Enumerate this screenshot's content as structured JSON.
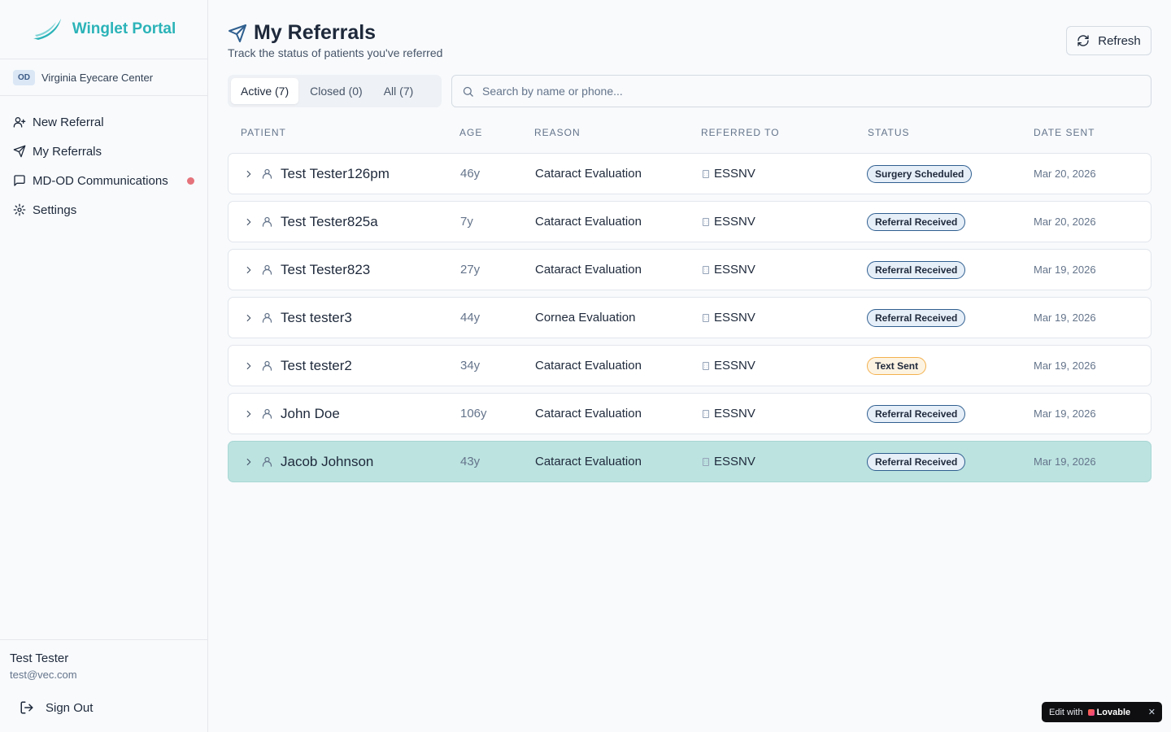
{
  "brand": {
    "title": "Winglet Portal"
  },
  "org": {
    "badge": "OD",
    "name": "Virginia Eyecare Center"
  },
  "nav": {
    "items": [
      {
        "label": "New Referral",
        "icon": "user-plus-icon"
      },
      {
        "label": "My Referrals",
        "icon": "send-icon"
      },
      {
        "label": "MD-OD Communications",
        "icon": "message-icon",
        "has_notification": true
      },
      {
        "label": "Settings",
        "icon": "gear-icon"
      }
    ]
  },
  "user": {
    "name": "Test Tester",
    "email": "test@vec.com",
    "signout_label": "Sign Out"
  },
  "header": {
    "title": "My Referrals",
    "subtitle": "Track the status of patients you've referred",
    "refresh_label": "Refresh"
  },
  "tabs": [
    {
      "label": "Active (7)",
      "active": true
    },
    {
      "label": "Closed (0)",
      "active": false
    },
    {
      "label": "All (7)",
      "active": false
    }
  ],
  "search": {
    "placeholder": "Search by name or phone...",
    "value": ""
  },
  "table": {
    "columns": [
      "PATIENT",
      "AGE",
      "REASON",
      "REFERRED TO",
      "STATUS",
      "DATE SENT"
    ],
    "rows": [
      {
        "name": "Test Tester126pm",
        "age": "46y",
        "reason": "Cataract Evaluation",
        "referred_to": "ESSNV",
        "status": "Surgery Scheduled",
        "date": "Mar 20, 2026"
      },
      {
        "name": "Test Tester825a",
        "age": "7y",
        "reason": "Cataract Evaluation",
        "referred_to": "ESSNV",
        "status": "Referral Received",
        "date": "Mar 20, 2026"
      },
      {
        "name": "Test Tester823",
        "age": "27y",
        "reason": "Cataract Evaluation",
        "referred_to": "ESSNV",
        "status": "Referral Received",
        "date": "Mar 19, 2026"
      },
      {
        "name": "Test tester3",
        "age": "44y",
        "reason": "Cornea Evaluation",
        "referred_to": "ESSNV",
        "status": "Referral Received",
        "date": "Mar 19, 2026"
      },
      {
        "name": "Test tester2",
        "age": "34y",
        "reason": "Cataract Evaluation",
        "referred_to": "ESSNV",
        "status": "Text Sent",
        "date": "Mar 19, 2026"
      },
      {
        "name": "John Doe",
        "age": "106y",
        "reason": "Cataract Evaluation",
        "referred_to": "ESSNV",
        "status": "Referral Received",
        "date": "Mar 19, 2026"
      },
      {
        "name": "Jacob Johnson",
        "age": "43y",
        "reason": "Cataract Evaluation",
        "referred_to": "ESSNV",
        "status": "Referral Received",
        "date": "Mar 19, 2026",
        "highlighted": true
      }
    ]
  },
  "lovable": {
    "prefix": "Edit with",
    "brand": "Lovable",
    "close": "✕"
  },
  "colors": {
    "brand": "#2bb3b8",
    "accent": "#2f5f8f",
    "highlight_row": "#bce3e0",
    "warning": "#f3b14e",
    "notification": "#e5737b"
  }
}
